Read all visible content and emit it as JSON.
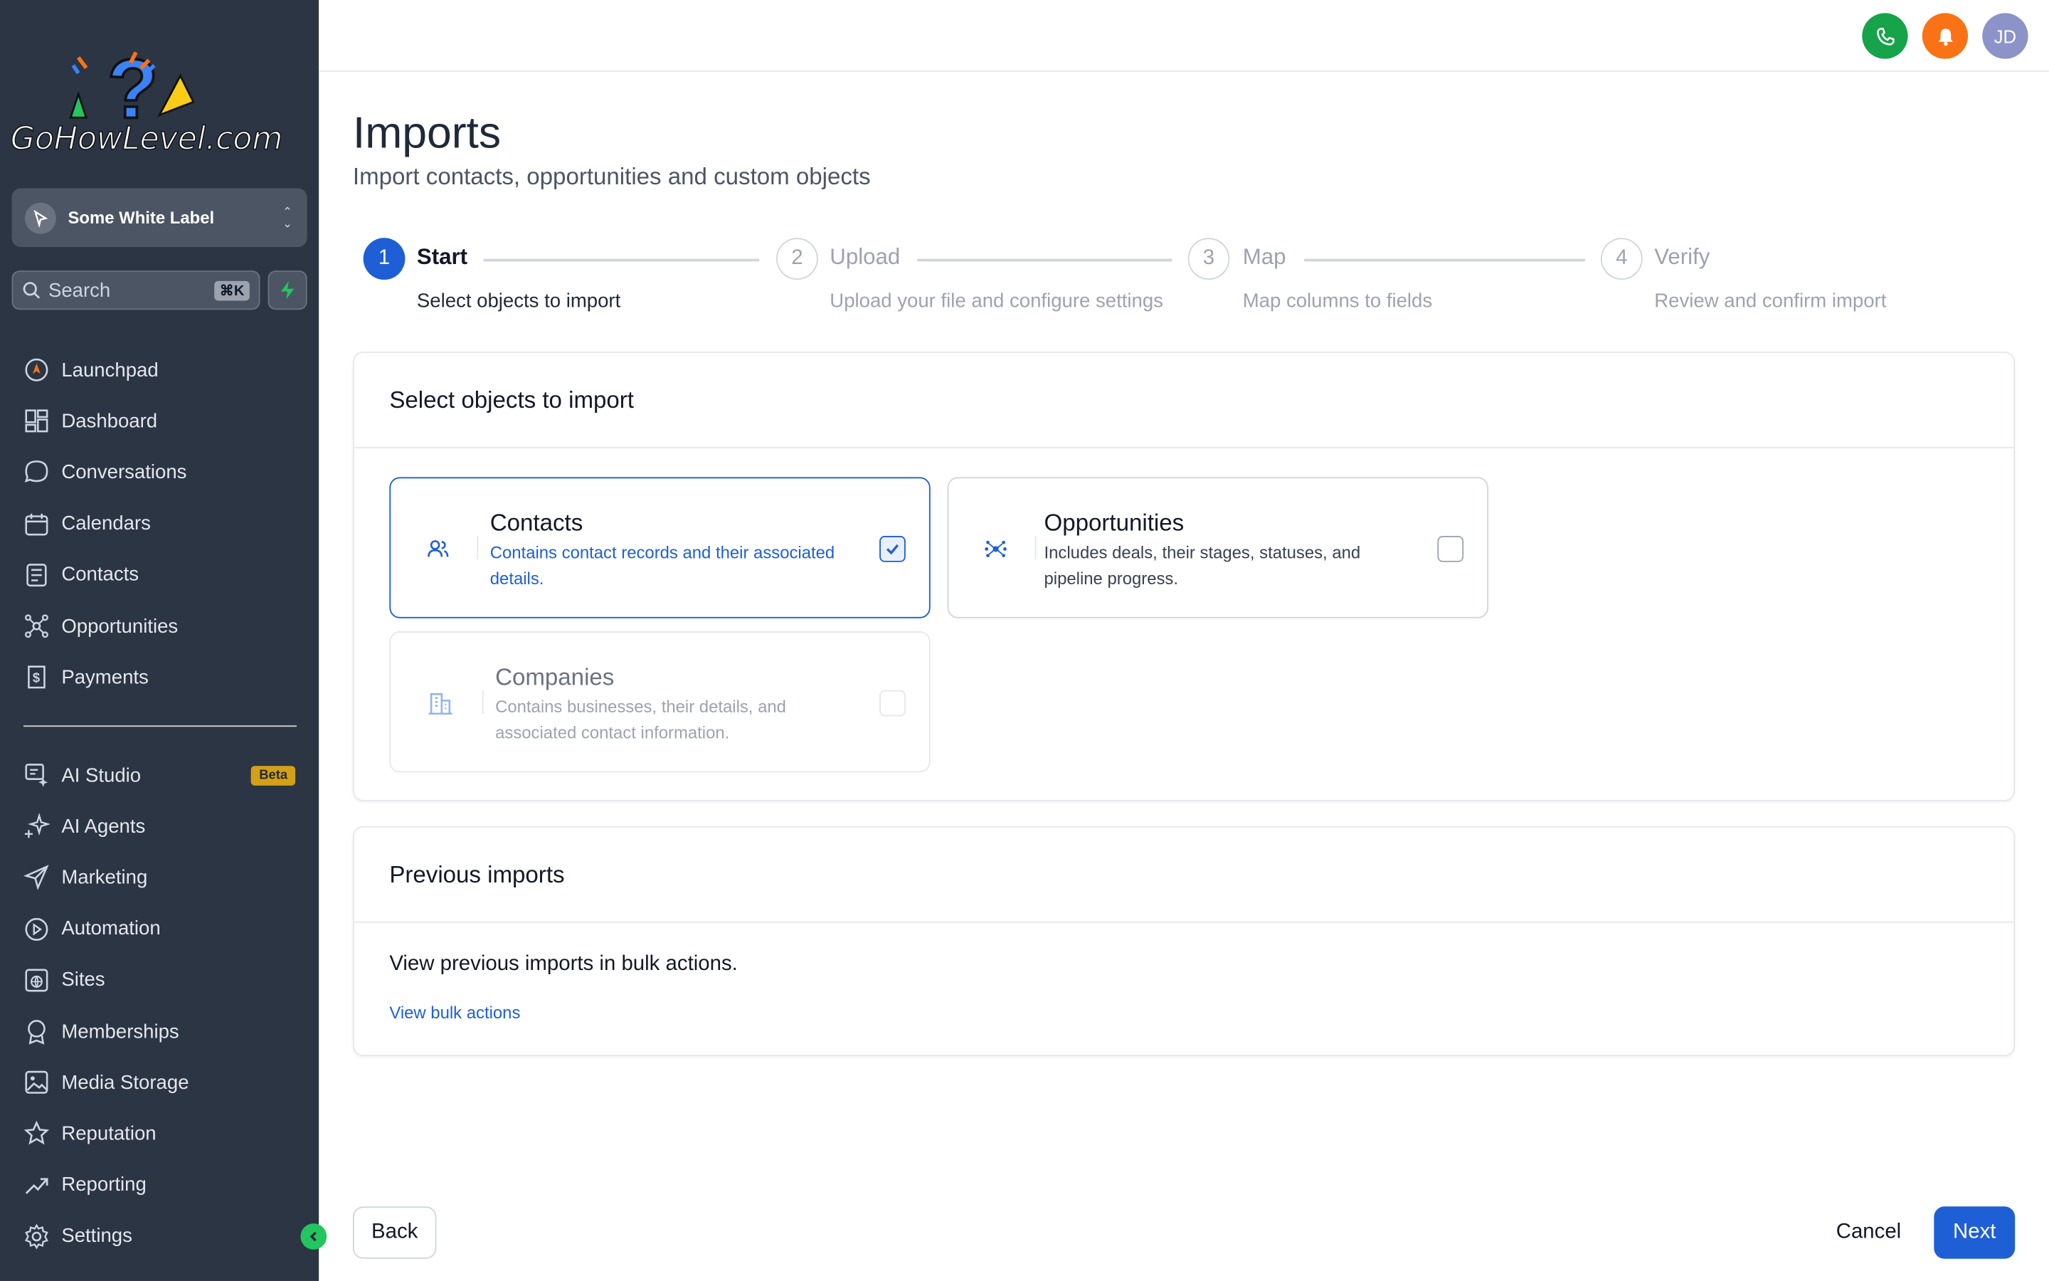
{
  "brand": {
    "logo_text": "GoHowLevel.com"
  },
  "sidebar": {
    "workspace": "Some White Label",
    "search_placeholder": "Search",
    "search_shortcut": "⌘K",
    "primary": [
      {
        "label": "Launchpad",
        "icon": "launchpad-icon"
      },
      {
        "label": "Dashboard",
        "icon": "dashboard-icon"
      },
      {
        "label": "Conversations",
        "icon": "chat-icon"
      },
      {
        "label": "Calendars",
        "icon": "calendar-icon"
      },
      {
        "label": "Contacts",
        "icon": "contacts-icon"
      },
      {
        "label": "Opportunities",
        "icon": "opportunities-icon"
      },
      {
        "label": "Payments",
        "icon": "payments-icon"
      }
    ],
    "secondary": [
      {
        "label": "AI Studio",
        "icon": "ai-studio-icon",
        "badge": "Beta"
      },
      {
        "label": "AI Agents",
        "icon": "sparkle-icon"
      },
      {
        "label": "Marketing",
        "icon": "send-icon"
      },
      {
        "label": "Automation",
        "icon": "automation-icon"
      },
      {
        "label": "Sites",
        "icon": "globe-icon"
      },
      {
        "label": "Memberships",
        "icon": "badge-icon"
      },
      {
        "label": "Media Storage",
        "icon": "image-icon"
      },
      {
        "label": "Reputation",
        "icon": "star-icon"
      },
      {
        "label": "Reporting",
        "icon": "trend-icon"
      },
      {
        "label": "Settings",
        "icon": "gear-icon"
      }
    ]
  },
  "topbar": {
    "avatar_initials": "JD",
    "phone_color": "#16a34a",
    "bell_color": "#f97316",
    "avatar_color": "#8b93c9"
  },
  "page": {
    "title": "Imports",
    "subtitle": "Import contacts, opportunities and custom objects"
  },
  "steps": [
    {
      "number": "1",
      "title": "Start",
      "desc": "Select objects to import",
      "active": true
    },
    {
      "number": "2",
      "title": "Upload",
      "desc": "Upload your file and configure settings",
      "active": false
    },
    {
      "number": "3",
      "title": "Map",
      "desc": "Map columns to fields",
      "active": false
    },
    {
      "number": "4",
      "title": "Verify",
      "desc": "Review and confirm import",
      "active": false
    }
  ],
  "select_card": {
    "heading": "Select objects to import",
    "objects": [
      {
        "title": "Contacts",
        "desc": "Contains contact records and their associated details.",
        "checked": true
      },
      {
        "title": "Opportunities",
        "desc": "Includes deals, their stages, statuses, and pipeline progress.",
        "checked": false
      },
      {
        "title": "Companies",
        "desc": "Contains businesses, their details, and associated contact information.",
        "checked": false,
        "disabled": true
      }
    ]
  },
  "previous_card": {
    "heading": "Previous imports",
    "text": "View previous imports in bulk actions.",
    "link": "View bulk actions"
  },
  "footer": {
    "back": "Back",
    "cancel": "Cancel",
    "next": "Next"
  },
  "colors": {
    "accent": "#1e5fd6",
    "sidebar_bg": "#2b3544"
  }
}
